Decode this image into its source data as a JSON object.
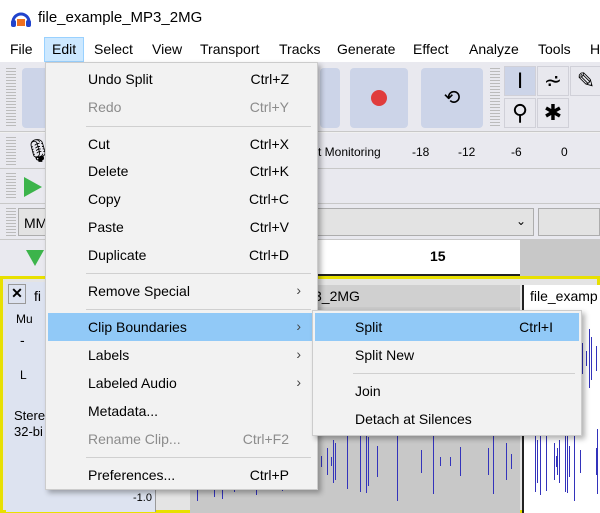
{
  "window": {
    "title": "file_example_MP3_2MG",
    "icon": "audacity-headphones-icon"
  },
  "menubar": [
    "File",
    "Edit",
    "Select",
    "View",
    "Transport",
    "Tracks",
    "Generate",
    "Effect",
    "Analyze",
    "Tools",
    "H"
  ],
  "meter": {
    "label": "t Monitoring",
    "ticks": [
      "-18",
      "-12",
      "-6",
      "0"
    ]
  },
  "device": {
    "value": "MM"
  },
  "ruler": {
    "tick": "15"
  },
  "track": {
    "mute": "Mu",
    "gain": "-",
    "pan": "L",
    "info1": "Stere",
    "info2": "32-bi",
    "clip1_name": "fi",
    "clip2_name": "3_2MG",
    "clip3_name": "file_examp",
    "scale": "-1.0"
  },
  "edit_menu": [
    {
      "label": "Undo Split",
      "shortcut": "Ctrl+Z"
    },
    {
      "label": "Redo",
      "shortcut": "Ctrl+Y",
      "disabled": true
    },
    {
      "label": "Cut",
      "shortcut": "Ctrl+X"
    },
    {
      "label": "Delete",
      "shortcut": "Ctrl+K"
    },
    {
      "label": "Copy",
      "shortcut": "Ctrl+C"
    },
    {
      "label": "Paste",
      "shortcut": "Ctrl+V"
    },
    {
      "label": "Duplicate",
      "shortcut": "Ctrl+D"
    },
    {
      "label": "Remove Special",
      "submenu": true
    },
    {
      "label": "Clip Boundaries",
      "submenu": true,
      "highlighted": true
    },
    {
      "label": "Labels",
      "submenu": true
    },
    {
      "label": "Labeled Audio",
      "submenu": true
    },
    {
      "label": "Metadata..."
    },
    {
      "label": "Rename Clip...",
      "shortcut": "Ctrl+F2",
      "disabled": true
    },
    {
      "label": "Preferences...",
      "shortcut": "Ctrl+P"
    }
  ],
  "submenu": [
    {
      "label": "Split",
      "shortcut": "Ctrl+I",
      "highlighted": true
    },
    {
      "label": "Split New"
    },
    {
      "label": "Join"
    },
    {
      "label": "Detach at Silences"
    }
  ],
  "colors": {
    "record": "#e03c3c",
    "play": "#3cb44b",
    "highlight": "#91c9f7",
    "waveform": "#3333bb",
    "track_border": "#e8e000"
  }
}
